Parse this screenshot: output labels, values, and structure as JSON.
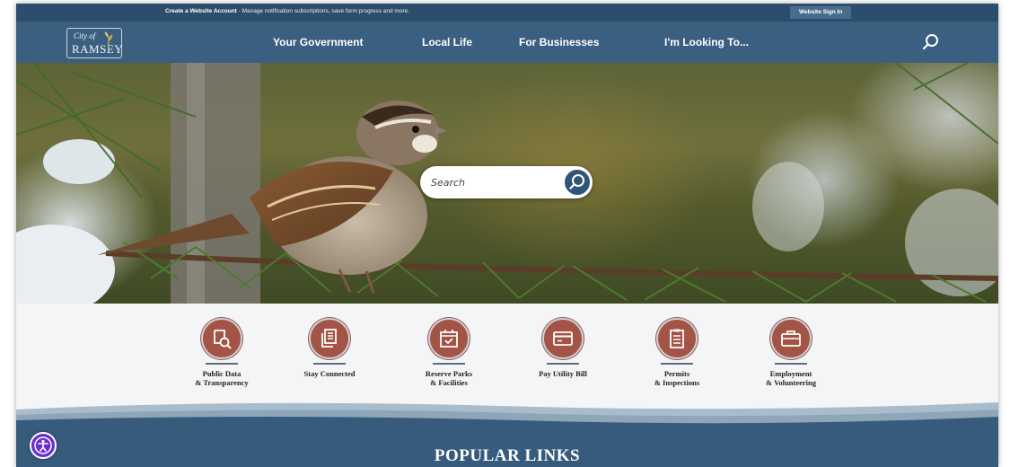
{
  "topbar": {
    "account_link": "Create a Website Account",
    "account_text": " - Manage notification subscriptions, save form progress and more.",
    "signin_label": "Website Sign In"
  },
  "logo": {
    "city": "City of",
    "name": "RAMSEY"
  },
  "nav": {
    "items": [
      "Your Government",
      "Local Life",
      "For Businesses",
      "I'm Looking To..."
    ]
  },
  "search": {
    "placeholder": "Search"
  },
  "quicklinks": [
    {
      "label": "Public Data\n& Transparency",
      "icon": "magnifier-document-icon"
    },
    {
      "label": "Stay Connected",
      "icon": "newsletter-icon"
    },
    {
      "label": "Reserve Parks\n& Facilities",
      "icon": "calendar-check-icon"
    },
    {
      "label": "Pay Utility Bill",
      "icon": "credit-card-icon"
    },
    {
      "label": "Permits\n& Inspections",
      "icon": "clipboard-list-icon"
    },
    {
      "label": "Employment\n& Volunteering",
      "icon": "briefcase-icon"
    }
  ],
  "popular": {
    "title": "POPULAR LINKS"
  },
  "colors": {
    "topbar": "#2c4d6b",
    "nav": "#3b5f80",
    "accent_button": "#2f5678",
    "icon_circle": "#a35446",
    "accessibility": "#6a2fd0"
  }
}
